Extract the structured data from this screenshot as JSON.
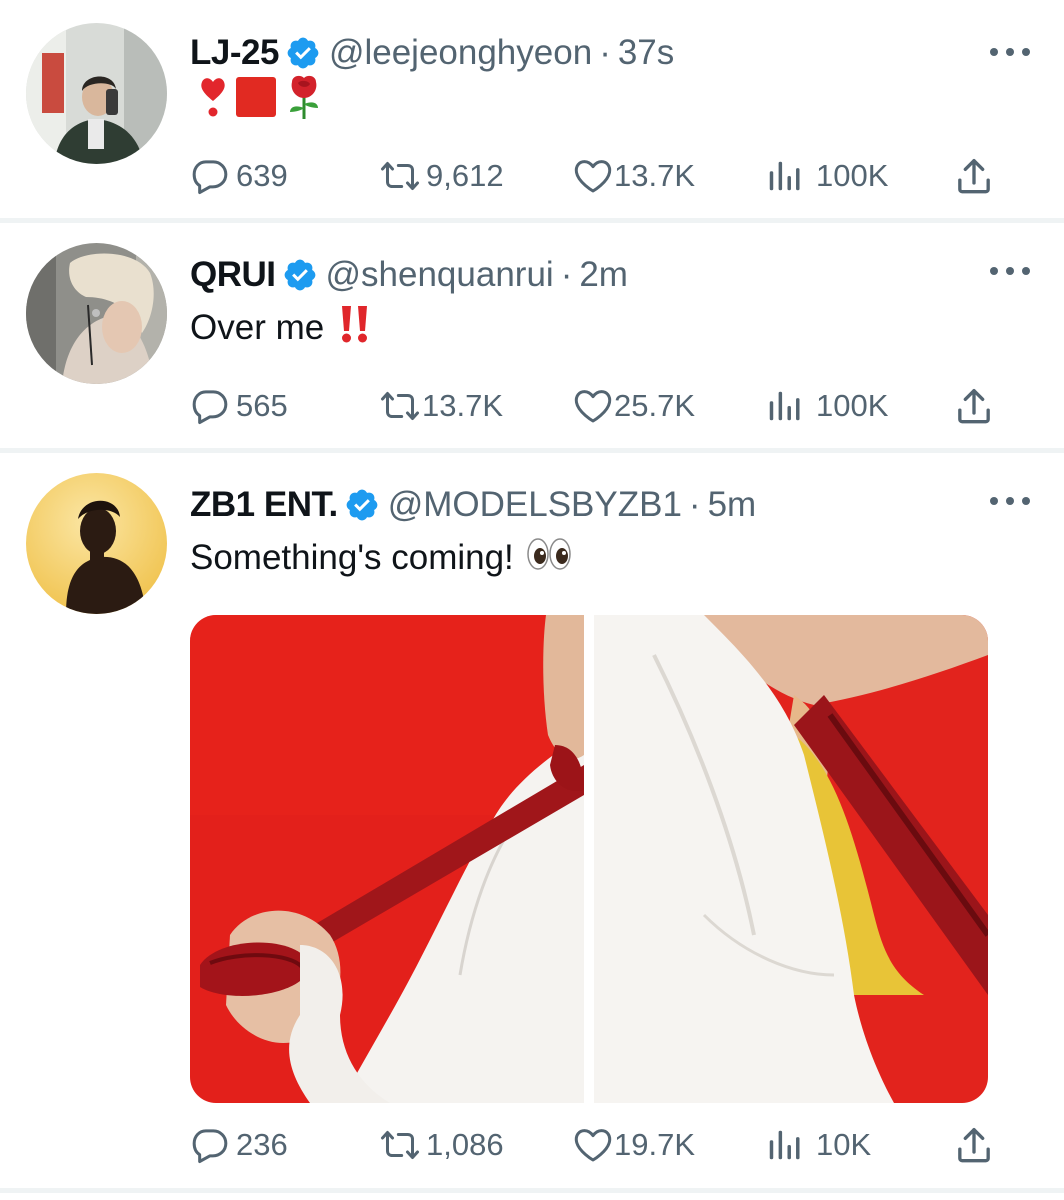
{
  "tweets": [
    {
      "name": "LJ-25",
      "handle": "@leejeonghyeon",
      "sep": "·",
      "time": "37s",
      "text": "",
      "emojis": [
        "heavy-heart-exclamation",
        "red-square",
        "rose"
      ],
      "replies": "639",
      "retweets": "9,612",
      "likes": "13.7K",
      "views": "100K"
    },
    {
      "name": "QRUI",
      "handle": "@shenquanrui",
      "sep": "·",
      "time": "2m",
      "text": "Over me",
      "emojis": [
        "double-exclamation"
      ],
      "replies": "565",
      "retweets": "13.7K",
      "likes": "25.7K",
      "views": "100K"
    },
    {
      "name": "ZB1 ENT.",
      "handle": "@MODELSBYZB1",
      "sep": "·",
      "time": "5m",
      "text": "Something's coming!",
      "emojis": [
        "eyes"
      ],
      "replies": "236",
      "retweets": "1,086",
      "likes": "19.7K",
      "views": "10K",
      "media": [
        "photo-red-ribbon-white-shirt",
        "photo-closeup-collar-red-ribbon"
      ]
    }
  ],
  "icons": {
    "verified": "verified-badge-icon",
    "more": "more-options-icon",
    "reply": "reply-icon",
    "retweet": "retweet-icon",
    "like": "heart-icon",
    "views": "views-chart-icon",
    "share": "share-icon"
  },
  "colors": {
    "verified": "#1d9bf0",
    "secondary_text": "#536471",
    "divider": "#eff3f4",
    "red": "#e3201b"
  }
}
